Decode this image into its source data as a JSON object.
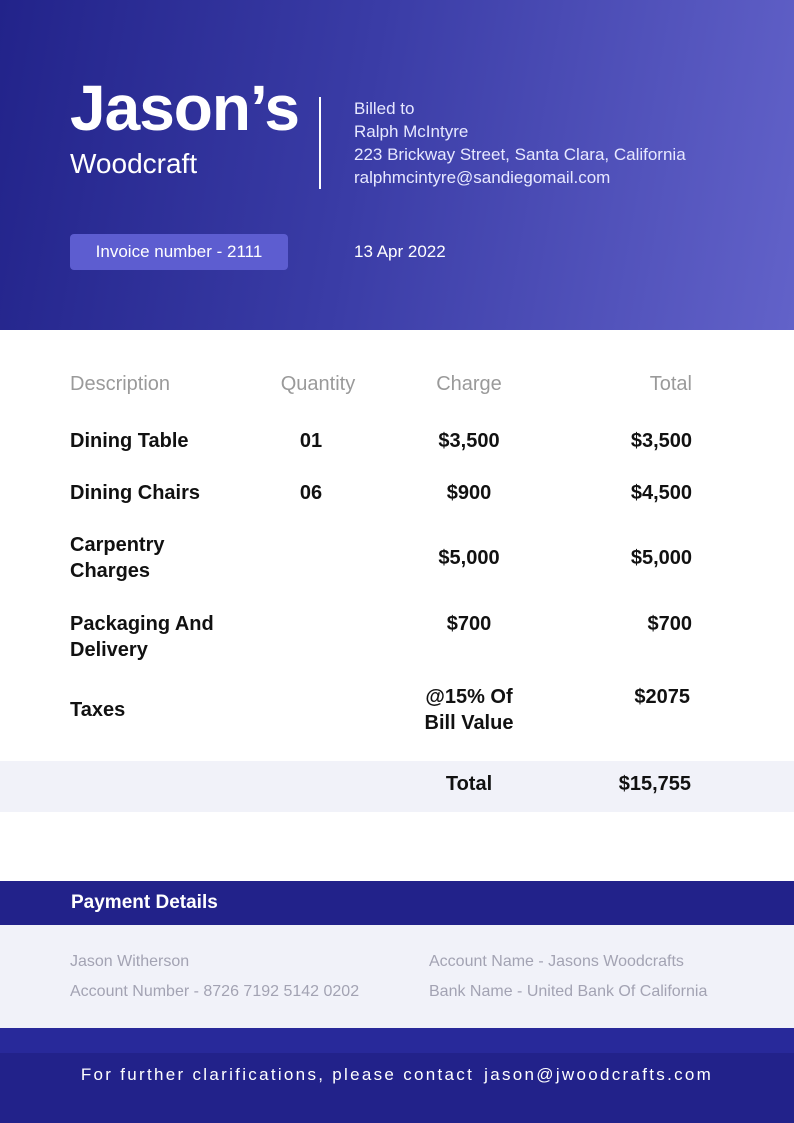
{
  "brand": {
    "name": "Jason’s",
    "subtitle": "Woodcraft"
  },
  "billing": {
    "label": "Billed to",
    "name": "Ralph McIntyre",
    "address": "223 Brickway Street, Santa Clara, California",
    "email": "ralphmcintyre@sandiegomail.com"
  },
  "invoice": {
    "number_label": "Invoice number - 2111",
    "date": "13 Apr 2022"
  },
  "table": {
    "headers": {
      "description": "Description",
      "quantity": "Quantity",
      "charge": "Charge",
      "total": "Total"
    },
    "rows": [
      {
        "description": "Dining Table",
        "quantity": "01",
        "charge": "$3,500",
        "total": "$3,500"
      },
      {
        "description": "Dining Chairs",
        "quantity": "06",
        "charge": "$900",
        "total": "$4,500"
      },
      {
        "description": "Carpentry Charges",
        "quantity": "",
        "charge": "$5,000",
        "total": "$5,000"
      },
      {
        "description": "Packaging And Delivery",
        "quantity": "",
        "charge": "$700",
        "total": "$700"
      },
      {
        "description": "Taxes",
        "quantity": "",
        "charge": "@15% Of Bill Value",
        "total": "$2075"
      }
    ],
    "grand_total_label": "Total",
    "grand_total_value": "$15,755"
  },
  "payment": {
    "title": "Payment Details",
    "holder": "Jason Witherson",
    "account_number": "Account Number - 8726 7192 5142 0202",
    "account_name": "Account Name - Jasons Woodcrafts",
    "bank_name": "Bank Name - United Bank Of California"
  },
  "footer": {
    "text": "For further clarifications, please contact",
    "email": "jason@jwoodcrafts.com"
  },
  "colors": {
    "header_start": "#22238a",
    "header_end": "#6262c9",
    "badge": "#5d5dd0",
    "navy": "#22228a",
    "light_band": "#f1f2f9"
  }
}
